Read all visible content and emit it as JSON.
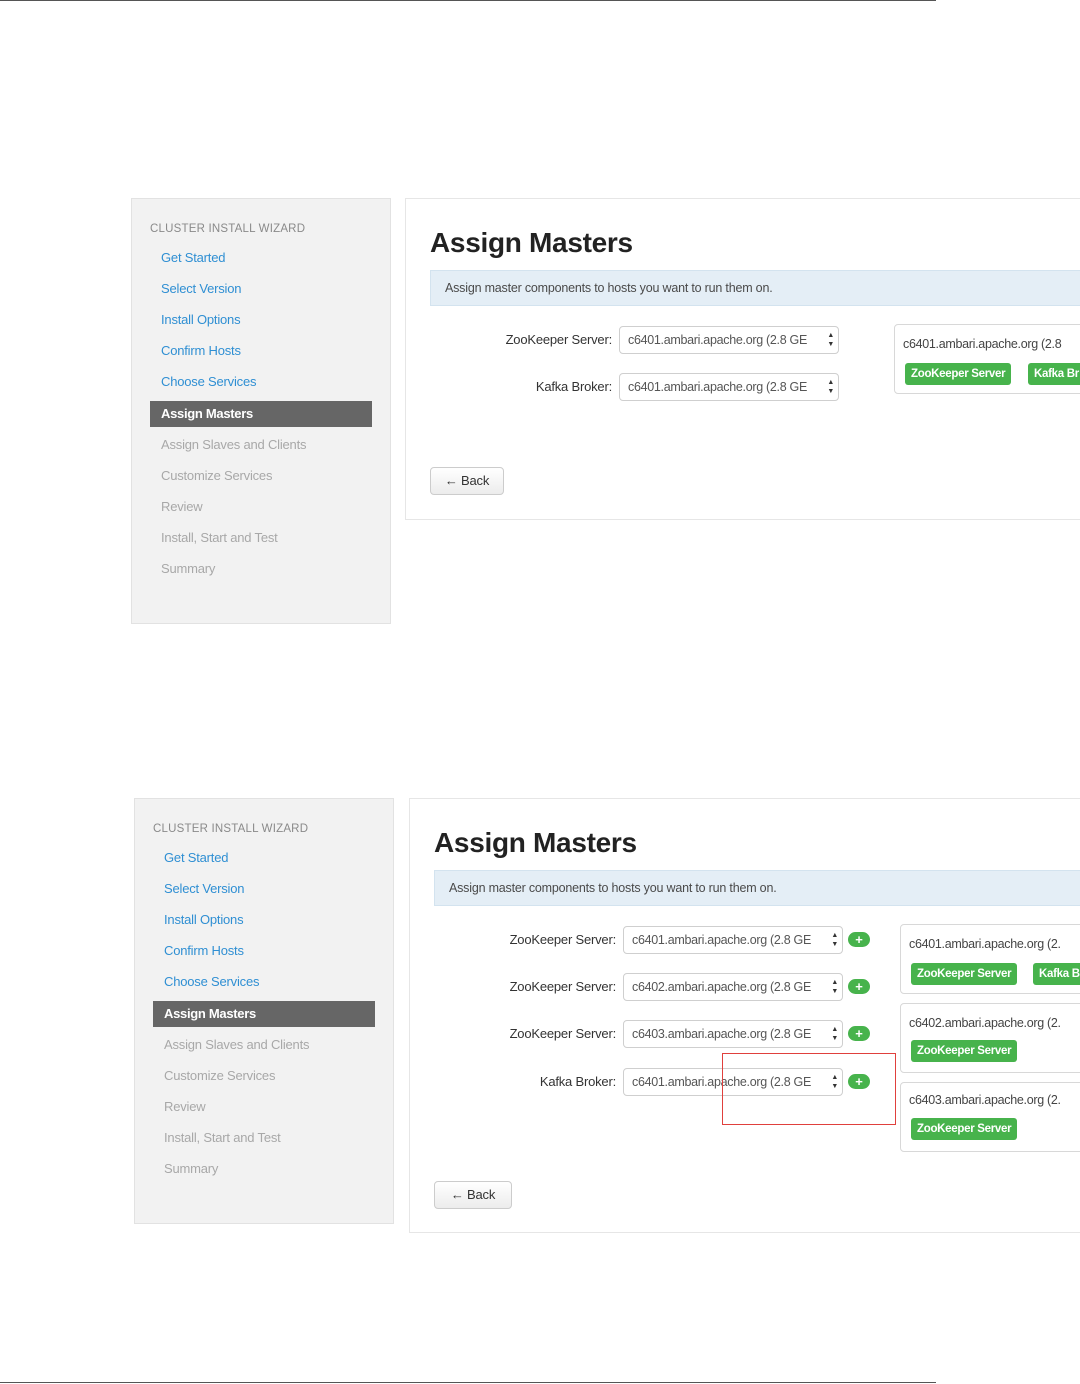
{
  "wizard": {
    "title": "CLUSTER INSTALL WIZARD",
    "steps_done": [
      "Get Started",
      "Select Version",
      "Install Options",
      "Confirm Hosts",
      "Choose Services"
    ],
    "step_active": "Assign Masters",
    "steps_todo": [
      "Assign Slaves and Clients",
      "Customize Services",
      "Review",
      "Install, Start and Test",
      "Summary"
    ]
  },
  "page": {
    "title": "Assign Masters",
    "info": "Assign master components to hosts you want to run them on.",
    "back_label": "← Back"
  },
  "screenshot1": {
    "rows": [
      {
        "label": "ZooKeeper Server:",
        "value": "c6401.ambari.apache.org (2.8 GE"
      },
      {
        "label": "Kafka Broker:",
        "value": "c6401.ambari.apache.org (2.8 GE"
      }
    ],
    "hosts": [
      {
        "name": "c6401.ambari.apache.org (2.8",
        "tags": [
          "ZooKeeper Server",
          "Kafka Br"
        ]
      }
    ]
  },
  "screenshot2": {
    "rows": [
      {
        "label": "ZooKeeper Server:",
        "value": "c6401.ambari.apache.org (2.8 GE"
      },
      {
        "label": "ZooKeeper Server:",
        "value": "c6402.ambari.apache.org (2.8 GE"
      },
      {
        "label": "ZooKeeper Server:",
        "value": "c6403.ambari.apache.org (2.8 GE"
      },
      {
        "label": "Kafka Broker:",
        "value": "c6401.ambari.apache.org (2.8 GE"
      }
    ],
    "hosts": [
      {
        "name": "c6401.ambari.apache.org (2.",
        "tags": [
          "ZooKeeper Server",
          "Kafka B"
        ]
      },
      {
        "name": "c6402.ambari.apache.org (2.",
        "tags": [
          "ZooKeeper Server"
        ]
      },
      {
        "name": "c6403.ambari.apache.org (2.",
        "tags": [
          "ZooKeeper Server"
        ]
      }
    ]
  },
  "icons": {
    "add": "plus-icon",
    "select_caret": "sort-caret-icon",
    "back": "arrow-left-icon"
  },
  "colors": {
    "link": "#2f8fd3",
    "active_step": "#666666",
    "tag_green": "#47b34c",
    "highlight": "#e0403d",
    "info_bg": "#e4eef6"
  }
}
